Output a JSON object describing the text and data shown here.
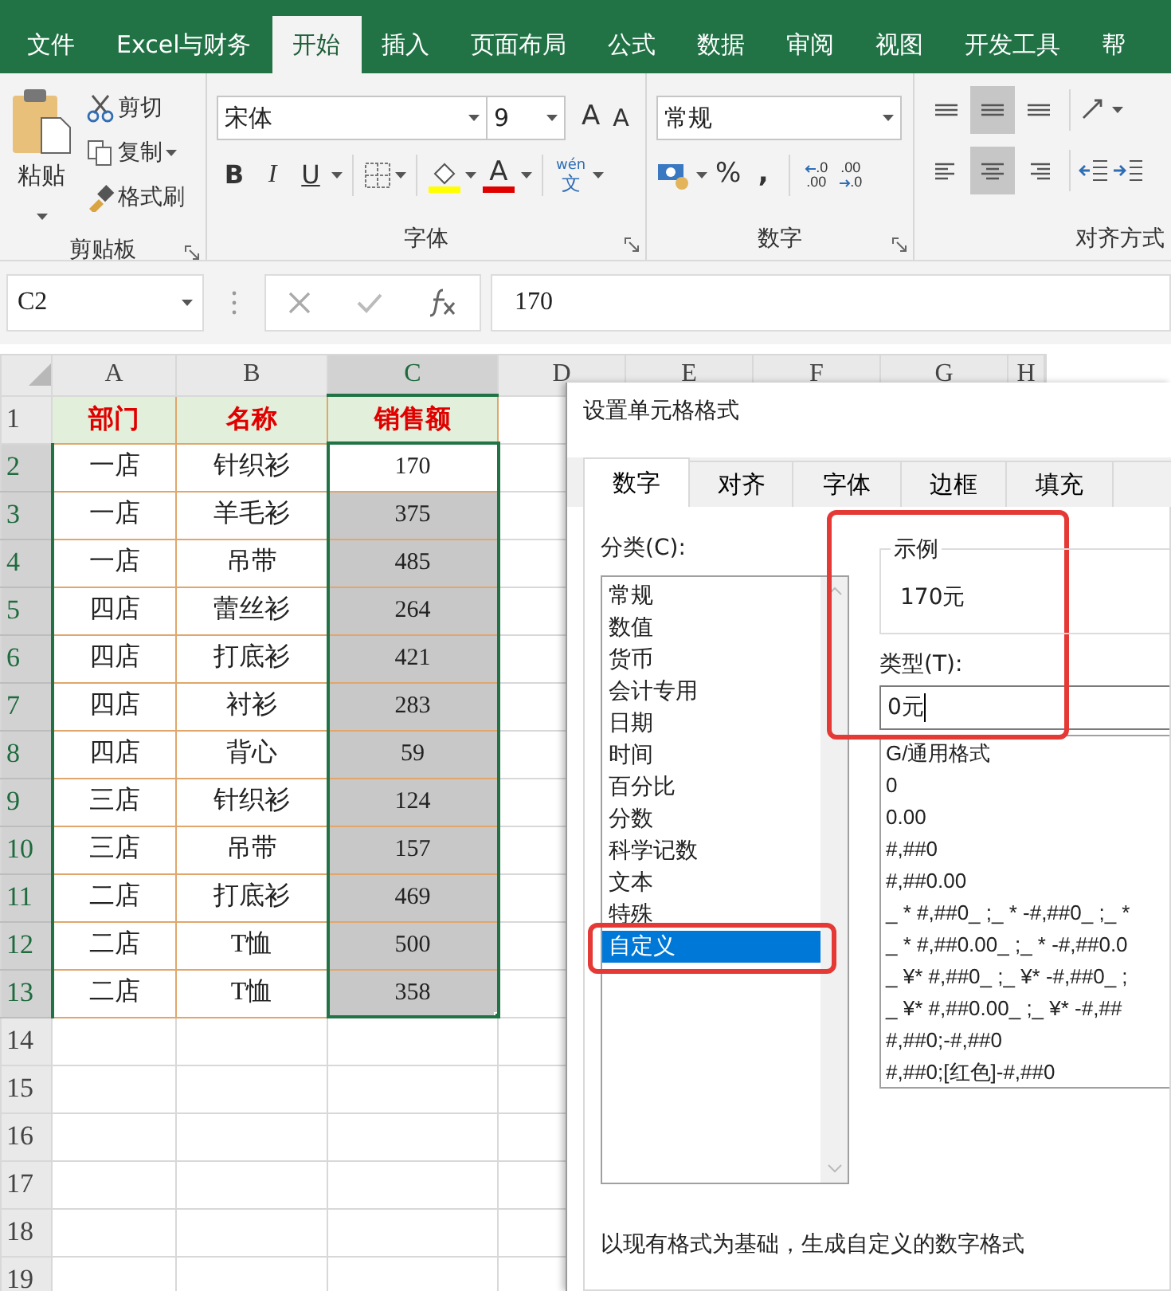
{
  "ribbon_tabs": [
    {
      "label": "文件",
      "selected": false
    },
    {
      "label": "Excel与财务",
      "selected": false
    },
    {
      "label": "开始",
      "selected": true
    },
    {
      "label": "插入",
      "selected": false
    },
    {
      "label": "页面布局",
      "selected": false
    },
    {
      "label": "公式",
      "selected": false
    },
    {
      "label": "数据",
      "selected": false
    },
    {
      "label": "审阅",
      "selected": false
    },
    {
      "label": "视图",
      "selected": false
    },
    {
      "label": "开发工具",
      "selected": false
    },
    {
      "label": "帮",
      "selected": false
    }
  ],
  "clipboard": {
    "paste": "粘贴",
    "cut": "剪切",
    "copy": "复制",
    "format_painter": "格式刷",
    "group_label": "剪贴板"
  },
  "font": {
    "name": "宋体",
    "size": "9",
    "grow": "A",
    "shrink": "A",
    "bold": "B",
    "italic": "I",
    "underline": "U",
    "font_color": "A",
    "phonetic": "wén",
    "phonetic_char": "文",
    "group_label": "字体"
  },
  "number": {
    "format": "常规",
    "percent": "%",
    "comma": ",",
    "increase_decimal": [
      ".0",
      ".00"
    ],
    "decrease_decimal": [
      ".00",
      ".0"
    ],
    "group_label": "数字"
  },
  "alignment": {
    "group_label": "对齐方式",
    "buttons": [
      {
        "kind": "top",
        "selected": false
      },
      {
        "kind": "middle",
        "selected": true
      },
      {
        "kind": "bottom",
        "selected": false
      },
      {
        "kind": "left",
        "selected": false
      },
      {
        "kind": "center",
        "selected": true
      },
      {
        "kind": "right",
        "selected": false
      }
    ]
  },
  "formula_bar": {
    "name_box": "C2",
    "value": "170"
  },
  "sheet": {
    "columns": [
      {
        "label": "A",
        "selected": false
      },
      {
        "label": "B",
        "selected": false
      },
      {
        "label": "C",
        "selected": true
      },
      {
        "label": "D",
        "selected": false
      },
      {
        "label": "E",
        "selected": false
      },
      {
        "label": "F",
        "selected": false
      },
      {
        "label": "G",
        "selected": false
      },
      {
        "label": "H",
        "selected": false
      }
    ],
    "rows": [
      {
        "number": "1",
        "kind": "header",
        "selected": false,
        "active": false,
        "cells": [
          "部门",
          "名称",
          "销售额"
        ]
      },
      {
        "number": "2",
        "kind": "data",
        "selected": true,
        "active": true,
        "cells": [
          "一店",
          "针织衫",
          "170"
        ]
      },
      {
        "number": "3",
        "kind": "data",
        "selected": true,
        "active": false,
        "cells": [
          "一店",
          "羊毛衫",
          "375"
        ]
      },
      {
        "number": "4",
        "kind": "data",
        "selected": true,
        "active": false,
        "cells": [
          "一店",
          "吊带",
          "485"
        ]
      },
      {
        "number": "5",
        "kind": "data",
        "selected": true,
        "active": false,
        "cells": [
          "四店",
          "蕾丝衫",
          "264"
        ]
      },
      {
        "number": "6",
        "kind": "data",
        "selected": true,
        "active": false,
        "cells": [
          "四店",
          "打底衫",
          "421"
        ]
      },
      {
        "number": "7",
        "kind": "data",
        "selected": true,
        "active": false,
        "cells": [
          "四店",
          "衬衫",
          "283"
        ]
      },
      {
        "number": "8",
        "kind": "data",
        "selected": true,
        "active": false,
        "cells": [
          "四店",
          "背心",
          "59"
        ]
      },
      {
        "number": "9",
        "kind": "data",
        "selected": true,
        "active": false,
        "cells": [
          "三店",
          "针织衫",
          "124"
        ]
      },
      {
        "number": "10",
        "kind": "data",
        "selected": true,
        "active": false,
        "cells": [
          "三店",
          "吊带",
          "157"
        ]
      },
      {
        "number": "11",
        "kind": "data",
        "selected": true,
        "active": false,
        "cells": [
          "二店",
          "打底衫",
          "469"
        ]
      },
      {
        "number": "12",
        "kind": "data",
        "selected": true,
        "active": false,
        "cells": [
          "二店",
          "T恤",
          "500"
        ]
      },
      {
        "number": "13",
        "kind": "data",
        "selected": true,
        "active": false,
        "cells": [
          "二店",
          "T恤",
          "358"
        ]
      },
      {
        "number": "14",
        "kind": "empty",
        "selected": false,
        "active": false
      },
      {
        "number": "15",
        "kind": "empty",
        "selected": false,
        "active": false
      },
      {
        "number": "16",
        "kind": "empty",
        "selected": false,
        "active": false
      },
      {
        "number": "17",
        "kind": "empty",
        "selected": false,
        "active": false
      },
      {
        "number": "18",
        "kind": "empty",
        "selected": false,
        "active": false
      },
      {
        "number": "19",
        "kind": "empty",
        "selected": false,
        "active": false
      }
    ]
  },
  "dialog": {
    "title": "设置单元格格式",
    "tabs": [
      {
        "label": "数字",
        "selected": true
      },
      {
        "label": "对齐",
        "selected": false
      },
      {
        "label": "字体",
        "selected": false
      },
      {
        "label": "边框",
        "selected": false
      },
      {
        "label": "填充",
        "selected": false
      }
    ],
    "category_label": "分类(C):",
    "categories": [
      {
        "label": "常规",
        "selected": false
      },
      {
        "label": "数值",
        "selected": false
      },
      {
        "label": "货币",
        "selected": false
      },
      {
        "label": "会计专用",
        "selected": false
      },
      {
        "label": "日期",
        "selected": false
      },
      {
        "label": "时间",
        "selected": false
      },
      {
        "label": "百分比",
        "selected": false
      },
      {
        "label": "分数",
        "selected": false
      },
      {
        "label": "科学记数",
        "selected": false
      },
      {
        "label": "文本",
        "selected": false
      },
      {
        "label": "特殊",
        "selected": false
      },
      {
        "label": "自定义",
        "selected": true
      }
    ],
    "sample_label": "示例",
    "sample_value": "170元",
    "type_label": "类型(T):",
    "type_value": "0元",
    "formats": [
      "G/通用格式",
      "0",
      "0.00",
      "#,##0",
      "#,##0.00",
      "_ * #,##0_ ;_ * -#,##0_ ;_ *",
      "_ * #,##0.00_ ;_ * -#,##0.0",
      "_ ¥* #,##0_ ;_ ¥* -#,##0_ ;",
      "_ ¥* #,##0.00_ ;_ ¥* -#,##",
      "#,##0;-#,##0",
      "#,##0;[红色]-#,##0"
    ],
    "description": "以现有格式为基础，生成自定义的数字格式"
  }
}
